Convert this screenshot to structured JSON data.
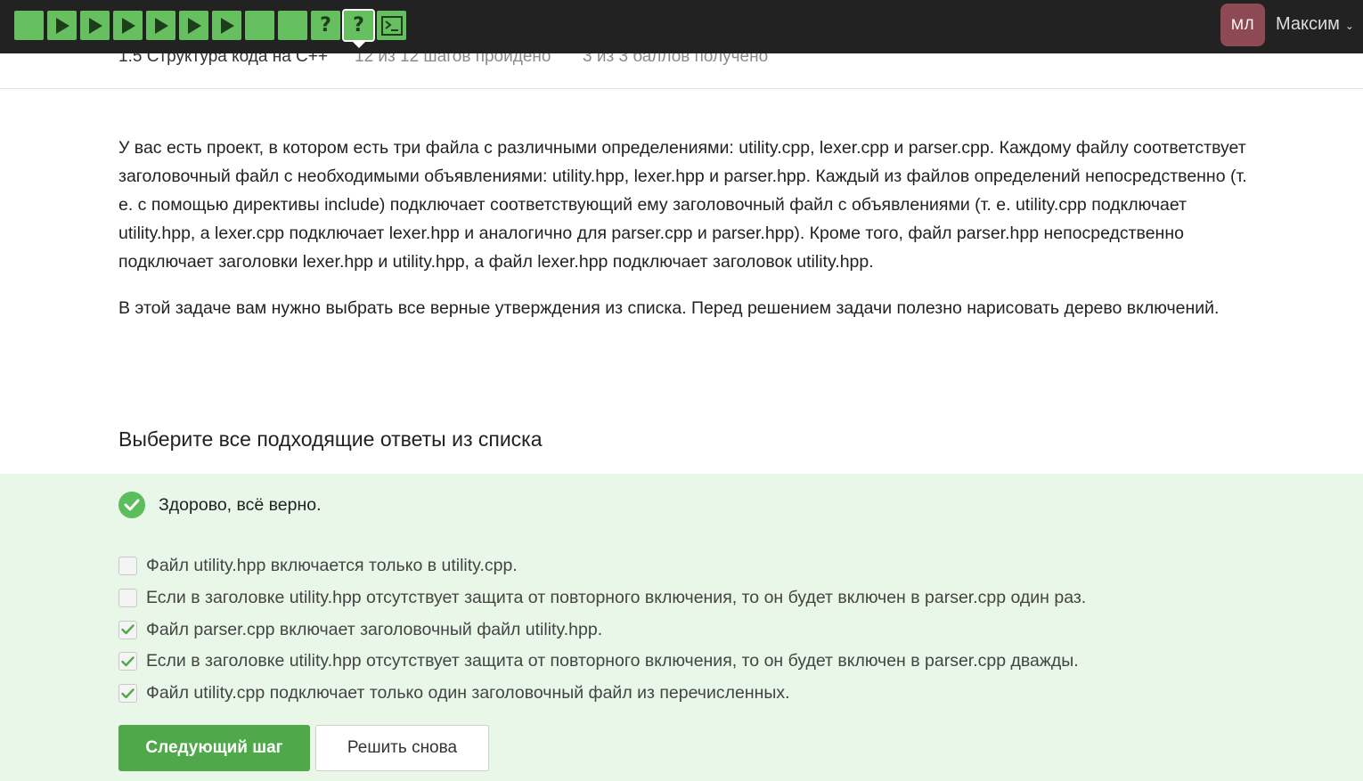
{
  "header": {
    "steps": [
      {
        "kind": "text",
        "icon": "text-step-icon"
      },
      {
        "kind": "video",
        "icon": "play-icon"
      },
      {
        "kind": "video",
        "icon": "play-icon"
      },
      {
        "kind": "video",
        "icon": "play-icon"
      },
      {
        "kind": "video",
        "icon": "play-icon"
      },
      {
        "kind": "video",
        "icon": "play-icon"
      },
      {
        "kind": "video",
        "icon": "play-icon"
      },
      {
        "kind": "text",
        "icon": "text-step-icon"
      },
      {
        "kind": "text",
        "icon": "text-step-icon"
      },
      {
        "kind": "quiz",
        "icon": "question-icon",
        "label": "?"
      },
      {
        "kind": "quiz",
        "icon": "question-icon",
        "label": "?",
        "active": true
      },
      {
        "kind": "code",
        "icon": "terminal-icon"
      }
    ],
    "user": {
      "initials": "МЛ",
      "name": "Максим",
      "avatar_color": "#8d4a55"
    }
  },
  "subheader": {
    "lesson_title": "1.5 Структура кода на C++",
    "progress": "12 из 12 шагов пройдено",
    "score": "3 из 3 баллов  получено"
  },
  "content": {
    "paragraphs": [
      "У вас есть проект, в котором есть три файла с различными определениями: utility.cpp, lexer.cpp и parser.cpp. Каждому файлу соответствует заголовочный файл с необходимыми объявлениями: utility.hpp, lexer.hpp и parser.hpp. Каждый из файлов определений непосредственно (т. е. с помощью директивы include) подключает соответствующий ему заголовочный файл с объявлениями (т. е. utility.cpp подключает utility.hpp, а lexer.cpp подключает lexer.hpp и аналогично для parser.cpp и parser.hpp). Кроме того, файл parser.hpp непосредственно подключает заголовки lexer.hpp и utility.hpp, а файл lexer.hpp подключает заголовок utility.hpp.",
      "В этой задаче вам нужно выбрать все верные утверждения из списка. Перед решением задачи полезно нарисовать дерево включений."
    ]
  },
  "quiz": {
    "title": "Выберите все подходящие ответы из списка",
    "feedback": "Здорово, всё верно.",
    "options": [
      {
        "label": "Файл utility.hpp включается только в utility.cpp.",
        "checked": false
      },
      {
        "label": "Если в заголовке utility.hpp отсутствует защита от повторного включения, то он будет включен в parser.cpp один раз.",
        "checked": false
      },
      {
        "label": "Файл parser.cpp включает заголовочный файл utility.hpp.",
        "checked": true
      },
      {
        "label": "Если в заголовке utility.hpp отсутствует защита от повторного включения, то он будет включен в parser.cpp дважды.",
        "checked": true
      },
      {
        "label": "Файл utility.cpp подключает только один заголовочный файл из перечисленных.",
        "checked": true
      }
    ],
    "next_button": "Следующий шаг",
    "retry_button": "Решить снова"
  },
  "colors": {
    "topbar": "#222222",
    "step_done": "#66c05f",
    "success_panel": "#e8f7e8",
    "primary_button": "#4fa84a",
    "check": "#4fa84a"
  }
}
